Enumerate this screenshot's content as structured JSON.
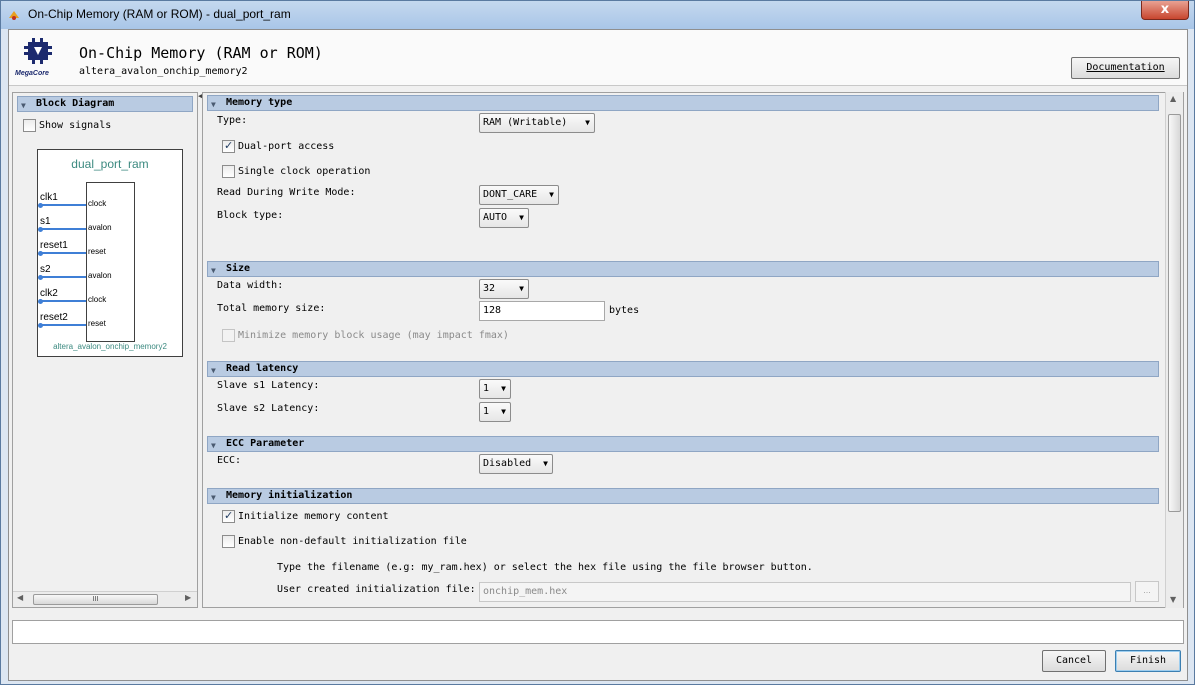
{
  "window": {
    "title": "On-Chip Memory (RAM or ROM) - dual_port_ram",
    "close_glyph": "x"
  },
  "header": {
    "logo_text": "MegaCore",
    "title": "On-Chip Memory (RAM or ROM)",
    "subtitle": "altera_avalon_onchip_memory2",
    "documentation_label": "Documentation"
  },
  "block_diagram": {
    "section_title": "Block Diagram",
    "show_signals_label": "Show signals",
    "show_signals_checked": false,
    "component_name": "dual_port_ram",
    "component_type": "altera_avalon_onchip_memory2",
    "signals": [
      {
        "name": "clk1",
        "port": "clock"
      },
      {
        "name": "s1",
        "port": "avalon"
      },
      {
        "name": "reset1",
        "port": "reset"
      },
      {
        "name": "s2",
        "port": "avalon"
      },
      {
        "name": "clk2",
        "port": "clock"
      },
      {
        "name": "reset2",
        "port": "reset"
      }
    ],
    "scroll_grip": "III"
  },
  "memory_type": {
    "section_title": "Memory type",
    "type_label": "Type:",
    "type_value": "RAM (Writable)",
    "dual_port_label": "Dual-port access",
    "dual_port_checked": true,
    "single_clock_label": "Single clock operation",
    "single_clock_checked": false,
    "rdw_label": "Read During Write Mode:",
    "rdw_value": "DONT_CARE",
    "block_type_label": "Block type:",
    "block_type_value": "AUTO"
  },
  "size": {
    "section_title": "Size",
    "data_width_label": "Data width:",
    "data_width_value": "32",
    "total_size_label": "Total memory size:",
    "total_size_value": "128",
    "total_size_unit": "bytes",
    "minimize_label": "Minimize memory block usage (may impact fmax)",
    "minimize_checked": false
  },
  "read_latency": {
    "section_title": "Read latency",
    "s1_label": "Slave s1 Latency:",
    "s1_value": "1",
    "s2_label": "Slave s2 Latency:",
    "s2_value": "1"
  },
  "ecc": {
    "section_title": "ECC Parameter",
    "ecc_label": "ECC:",
    "ecc_value": "Disabled"
  },
  "memory_init": {
    "section_title": "Memory initialization",
    "init_label": "Initialize memory content",
    "init_checked": true,
    "non_default_label": "Enable non-default initialization file",
    "non_default_checked": false,
    "hint": "Type the filename (e.g: my_ram.hex) or select the hex file using the file browser button.",
    "file_label": "User created initialization file:",
    "file_value": "onchip_mem.hex",
    "browse_label": "..."
  },
  "footer": {
    "status_text": "",
    "cancel_label": "Cancel",
    "finish_label": "Finish"
  }
}
